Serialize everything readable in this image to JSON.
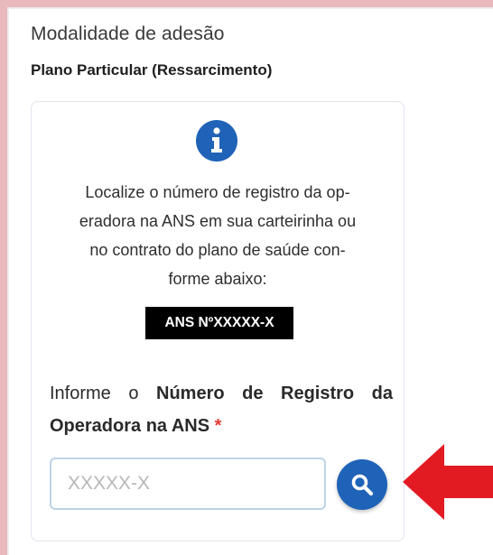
{
  "modality": {
    "label": "Modalidade de adesão",
    "value": "Plano Particular (Ressarcimento)"
  },
  "info_card": {
    "icon": "info-circle-icon",
    "help_lines": [
      "Localize o número de registro da op-",
      "eradora na ANS em sua carteirinha ou",
      "no contrato do plano de saúde con-",
      "forme abaixo:"
    ],
    "badge": "ANS NºXXXXX-X"
  },
  "registration_field": {
    "label_plain": "Informe o",
    "label_bold": "Número de Registro da Operadora na ANS",
    "required_mark": "*",
    "placeholder": "XXXXX-X",
    "value": "",
    "search_icon": "search-icon"
  },
  "annotation": {
    "icon": "red-arrow-left-icon",
    "color": "#e21b23"
  },
  "colors": {
    "primary": "#1f63b8",
    "required": "#e53935",
    "frame": "#e8b9bd"
  }
}
